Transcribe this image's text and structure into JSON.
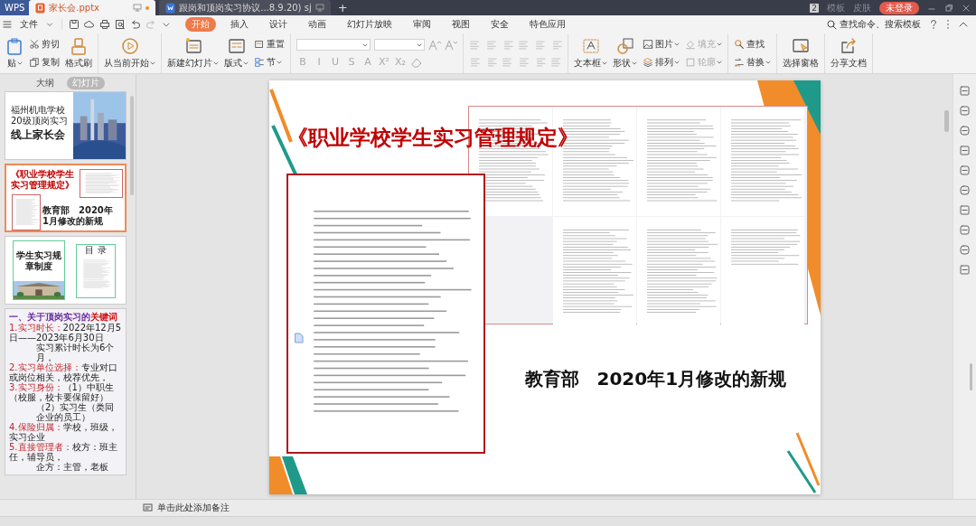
{
  "tabs": [
    {
      "label": "WPS",
      "kind": "home",
      "selected": false
    },
    {
      "label": "家长会.pptx",
      "kind": "ppt",
      "selected": true
    },
    {
      "label": "跟岗和顶岗实习协议...8.9.20) sj",
      "kind": "doc",
      "selected": false
    }
  ],
  "new_tab": "+",
  "title_bar": {
    "badge": "2",
    "links": [
      "模板",
      "皮肤"
    ],
    "login": "未登录"
  },
  "menu": {
    "file": "文件",
    "items": [
      {
        "label": "开始",
        "selected": true
      },
      {
        "label": "插入",
        "selected": false
      },
      {
        "label": "设计",
        "selected": false
      },
      {
        "label": "动画",
        "selected": false
      },
      {
        "label": "幻灯片放映",
        "selected": false
      },
      {
        "label": "审阅",
        "selected": false
      },
      {
        "label": "视图",
        "selected": false
      },
      {
        "label": "安全",
        "selected": false
      },
      {
        "label": "特色应用",
        "selected": false
      }
    ],
    "search": "查找命令、搜索模板"
  },
  "ribbon": {
    "groups_before": [
      [
        [
          {
            "label": "贴",
            "kind": "big",
            "dropdown": true,
            "disabled": false
          }
        ],
        [
          {
            "label": "剪切",
            "kind": "small",
            "dropdown": false,
            "disabled": false
          },
          {
            "label": "复制",
            "kind": "small",
            "dropdown": false,
            "disabled": false
          }
        ],
        [
          {
            "label": "格式刷",
            "kind": "big",
            "dropdown": false,
            "disabled": false
          }
        ]
      ],
      [
        [
          {
            "label": "从当前开始",
            "kind": "big",
            "dropdown": true,
            "disabled": false
          }
        ]
      ],
      [
        [
          {
            "label": "新建幻灯片",
            "kind": "big",
            "dropdown": true,
            "disabled": false
          }
        ],
        [
          {
            "label": "版式",
            "kind": "big",
            "dropdown": true,
            "disabled": false
          }
        ],
        [
          {
            "label": "重置",
            "kind": "small",
            "dropdown": false,
            "disabled": false
          },
          {
            "label": "节",
            "kind": "small",
            "dropdown": true,
            "disabled": false
          }
        ]
      ]
    ],
    "format_buttons": [
      "B",
      "I",
      "U",
      "S",
      "A",
      "X²",
      "X₂"
    ],
    "groups_after": [
      [
        [
          {
            "label": "文本框",
            "kind": "big",
            "dropdown": true,
            "disabled": false
          }
        ],
        [
          {
            "label": "形状",
            "kind": "big",
            "dropdown": true,
            "disabled": false
          }
        ],
        [
          {
            "label": "图片",
            "kind": "small",
            "dropdown": true,
            "disabled": false
          },
          {
            "label": "排列",
            "kind": "small",
            "dropdown": true,
            "disabled": false
          }
        ],
        [
          {
            "label": "填充",
            "kind": "small",
            "dropdown": true,
            "disabled": true
          },
          {
            "label": "轮廓",
            "kind": "small",
            "dropdown": true,
            "disabled": true
          }
        ]
      ],
      [
        [
          {
            "label": "查找",
            "kind": "small",
            "dropdown": false,
            "disabled": false
          },
          {
            "label": "替换",
            "kind": "small",
            "dropdown": true,
            "disabled": false
          }
        ]
      ],
      [
        [
          {
            "label": "选择窗格",
            "kind": "big",
            "dropdown": false,
            "disabled": false
          }
        ]
      ],
      [
        [
          {
            "label": "分享文档",
            "kind": "big",
            "dropdown": false,
            "disabled": false
          }
        ]
      ]
    ]
  },
  "sidebar": {
    "views": [
      {
        "label": "大纲",
        "selected": false
      },
      {
        "label": "幻灯片",
        "selected": true
      }
    ],
    "slides": [
      {
        "kind": "cover",
        "selected": false,
        "texts": [
          "福州机电学校20级顶岗实习",
          "线上家长会"
        ]
      },
      {
        "kind": "regulation",
        "selected": true,
        "texts": [
          "《职业学校学生实习管理规定》",
          "教育部　2020年1月修改的新规"
        ]
      },
      {
        "kind": "handbook",
        "selected": false,
        "texts": [
          "学生实习规章制度",
          "目 录"
        ]
      },
      {
        "kind": "keywords",
        "selected": false,
        "title": "一、关于顶岗实习的",
        "title_emphasis": "关键词",
        "lines": [
          {
            "label": "1.实习时长：",
            "text": "2022年12月5日——2023年6月30日"
          },
          {
            "text": "实习累计时长为6个月，"
          },
          {
            "label": "2.实习单位选择：",
            "text": "专业对口或岗位相关，校荐优先，"
          },
          {
            "label": "3.实习身份：",
            "text": "（1）中职生（校服，校卡要保留好）"
          },
          {
            "text": "（2）实习生（类同企业的员工）"
          },
          {
            "label": "4.保险归属：",
            "text": "学校，班级，实习企业"
          },
          {
            "label": "5.直接管理者：",
            "text": "校方：班主任，辅导员，"
          },
          {
            "text": "企方：主管，老板"
          }
        ]
      }
    ]
  },
  "slide": {
    "title": "《职业学校学生实习管理规定》",
    "caption": "教育部　2020年1月修改的新规"
  },
  "notes": {
    "placeholder": "单击此处添加备注"
  }
}
